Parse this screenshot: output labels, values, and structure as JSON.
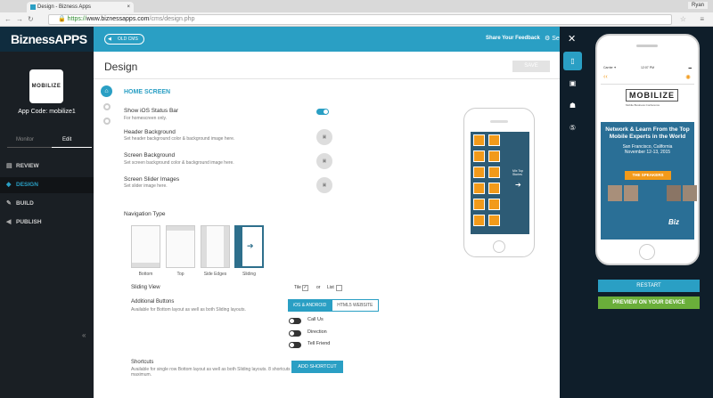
{
  "browser": {
    "tab_title": "Design - Bizness Apps",
    "user": "Ryan",
    "url_scheme": "https://",
    "url_host": "www.biznessapps.com",
    "url_path": "/cms/design.php"
  },
  "header": {
    "logo_part1": "Bizness",
    "logo_part2": "APPS",
    "old_cms": "OLD CMS",
    "feedback": "Share Your Feedback",
    "settings_mini": "Se"
  },
  "sidebar": {
    "badge": "MOBILIZE",
    "app_code": "App Code: mobilize1",
    "monitor": "Monitor",
    "edit": "Edit",
    "items": [
      {
        "label": "REVIEW",
        "icon": "document-icon"
      },
      {
        "label": "DESIGN",
        "icon": "palette-icon"
      },
      {
        "label": "BUILD",
        "icon": "wrench-icon"
      },
      {
        "label": "PUBLISH",
        "icon": "megaphone-icon"
      }
    ],
    "collapse": "«"
  },
  "main": {
    "title": "Design",
    "save": "SAVE",
    "section": "HOME SCREEN",
    "rows": [
      {
        "label": "Show iOS Status Bar",
        "sub": "For homescreen only."
      },
      {
        "label": "Header Background",
        "sub": "Set header background color & background image here."
      },
      {
        "label": "Screen Background",
        "sub": "Set screen background color & background image here."
      },
      {
        "label": "Screen Slider Images",
        "sub": "Set slider image here."
      }
    ],
    "nav_type": "Navigation Type",
    "nav_options": [
      "Bottom",
      "Top",
      "Side Edges",
      "Sliding"
    ],
    "sliding_view": "Sliding View",
    "tile": "Tile",
    "or": "or",
    "list": "List",
    "additional_buttons": "Additional Buttons",
    "additional_sub": "Available for Bottom layout as well as both Sliding layouts.",
    "seg_a": "iOS & ANDROID",
    "seg_b": "HTML5 WEBSITE",
    "toggles": [
      "Call Us",
      "Direction",
      "Tell Friend"
    ],
    "shortcuts": "Shortcuts",
    "shortcuts_sub": "Available for single row Bottom layout as well as both Sliding layouts. 8 shortcuts maximum.",
    "add_shortcut": "ADD SHORTCUT",
    "mini_text": "Mix Top Stories"
  },
  "preview": {
    "status_left": "Carrier ✦",
    "status_center": "12:07 PM",
    "status_right": "▬",
    "logo": "MOBILIZE",
    "tagline": "Mobile Business Conference",
    "hero_title": "Network & Learn From the Top Mobile Experts in the World",
    "hero_loc": "San Francisco, California",
    "hero_date": "November 12-13, 2015",
    "speakers": "THE SPEAKERS",
    "footer_logo": "Biz",
    "restart": "RESTART",
    "preview_device": "PREVIEW ON YOUR DEVICE"
  },
  "colors": {
    "accent": "#2a9fc4",
    "orange": "#f29a1a",
    "green": "#6aae3a",
    "dark": "#1a1f24"
  }
}
